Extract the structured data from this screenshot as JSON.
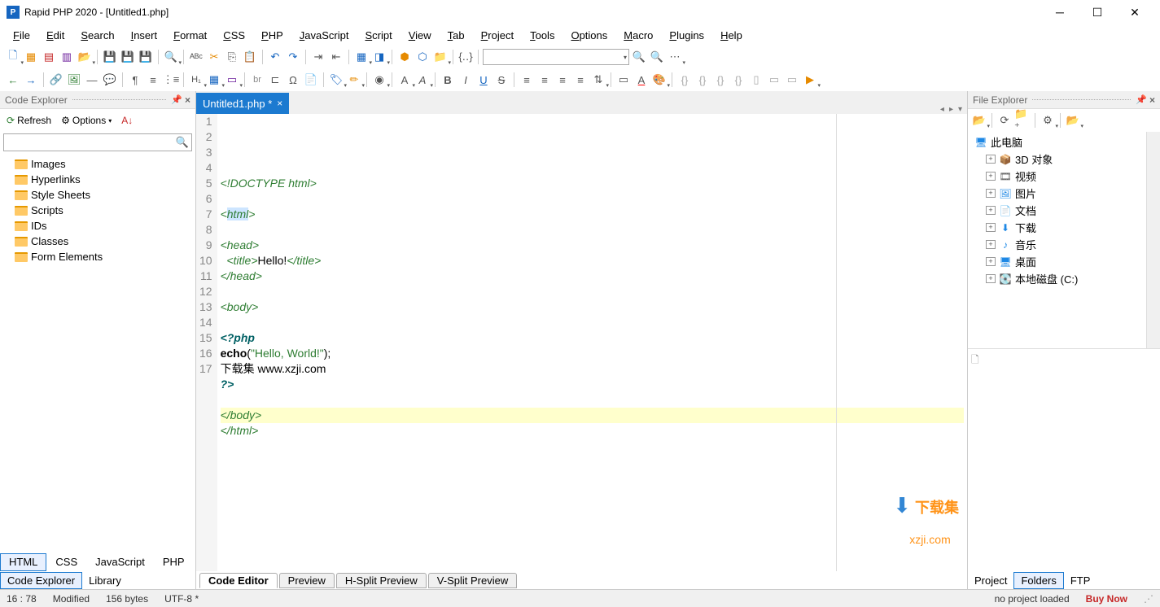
{
  "title": "Rapid PHP 2020 - [Untitled1.php]",
  "menus": [
    "File",
    "Edit",
    "Search",
    "Insert",
    "Format",
    "CSS",
    "PHP",
    "JavaScript",
    "Script",
    "View",
    "Tab",
    "Project",
    "Tools",
    "Options",
    "Macro",
    "Plugins",
    "Help"
  ],
  "codeExplorer": {
    "title": "Code Explorer",
    "refresh": "Refresh",
    "options": "Options",
    "items": [
      "Images",
      "Hyperlinks",
      "Style Sheets",
      "Scripts",
      "IDs",
      "Classes",
      "Form Elements"
    ]
  },
  "fileExplorer": {
    "title": "File Explorer",
    "root": "此电脑",
    "items": [
      {
        "label": "3D 对象",
        "icon": "📦",
        "color": "#1e88e5"
      },
      {
        "label": "视频",
        "icon": "🎞",
        "color": "#555"
      },
      {
        "label": "图片",
        "icon": "🖼",
        "color": "#1e88e5"
      },
      {
        "label": "文档",
        "icon": "📄",
        "color": "#555"
      },
      {
        "label": "下载",
        "icon": "⬇",
        "color": "#1e88e5"
      },
      {
        "label": "音乐",
        "icon": "♪",
        "color": "#1e88e5"
      },
      {
        "label": "桌面",
        "icon": "🖥",
        "color": "#1e88e5"
      },
      {
        "label": "本地磁盘 (C:)",
        "icon": "💽",
        "color": "#555"
      }
    ]
  },
  "tab": {
    "name": "Untitled1.php *"
  },
  "code": {
    "lines": [
      {
        "n": 1,
        "html": "<span class='c-doctype'>&lt;!DOCTYPE html&gt;</span>"
      },
      {
        "n": 2,
        "html": ""
      },
      {
        "n": 3,
        "html": "<span class='c-tag'>&lt;</span><span class='c-tag-hl'>html</span><span class='c-tag'>&gt;</span>"
      },
      {
        "n": 4,
        "html": ""
      },
      {
        "n": 5,
        "html": "<span class='c-tag'>&lt;head&gt;</span>"
      },
      {
        "n": 6,
        "html": "  <span class='c-tag'>&lt;title&gt;</span><span class='c-txt'>Hello!</span><span class='c-tag'>&lt;/title&gt;</span>"
      },
      {
        "n": 7,
        "html": "<span class='c-tag'>&lt;/head&gt;</span>"
      },
      {
        "n": 8,
        "html": ""
      },
      {
        "n": 9,
        "html": "<span class='c-tag'>&lt;body&gt;</span>"
      },
      {
        "n": 10,
        "html": ""
      },
      {
        "n": 11,
        "html": "<span class='c-kw'>&lt;?php</span>"
      },
      {
        "n": 12,
        "html": "<span class='c-func'>echo</span><span class='c-txt'>(</span><span class='c-str'>\"Hello, World!\"</span><span class='c-txt'>);</span>"
      },
      {
        "n": 13,
        "html": "<span class='c-txt'>下载集 www.xzji.com</span>"
      },
      {
        "n": 14,
        "html": "<span class='c-kw'>?&gt;</span>"
      },
      {
        "n": 15,
        "html": ""
      },
      {
        "n": 16,
        "html": "<span class='c-tag'>&lt;/body&gt;</span>"
      },
      {
        "n": 17,
        "html": "<span class='c-tag'>&lt;/html&gt;</span>"
      }
    ],
    "hlLine": 16
  },
  "langTabs": [
    "HTML",
    "CSS",
    "JavaScript",
    "PHP"
  ],
  "langActive": "HTML",
  "leftBottomTabs": [
    "Code Explorer",
    "Library"
  ],
  "leftBottomActive": "Code Explorer",
  "viewTabs": [
    "Code Editor",
    "Preview",
    "H-Split Preview",
    "V-Split Preview"
  ],
  "viewActive": "Code Editor",
  "rightBottomTabs": [
    "Project",
    "Folders",
    "FTP"
  ],
  "rightBottomActive": "Folders",
  "status": {
    "pos": "16 : 78",
    "mod": "Modified",
    "size": "156 bytes",
    "enc": "UTF-8 *",
    "proj": "no project loaded",
    "buy": "Buy Now"
  },
  "watermark": {
    "line1": "下载集",
    "line2": "xzji.com"
  }
}
